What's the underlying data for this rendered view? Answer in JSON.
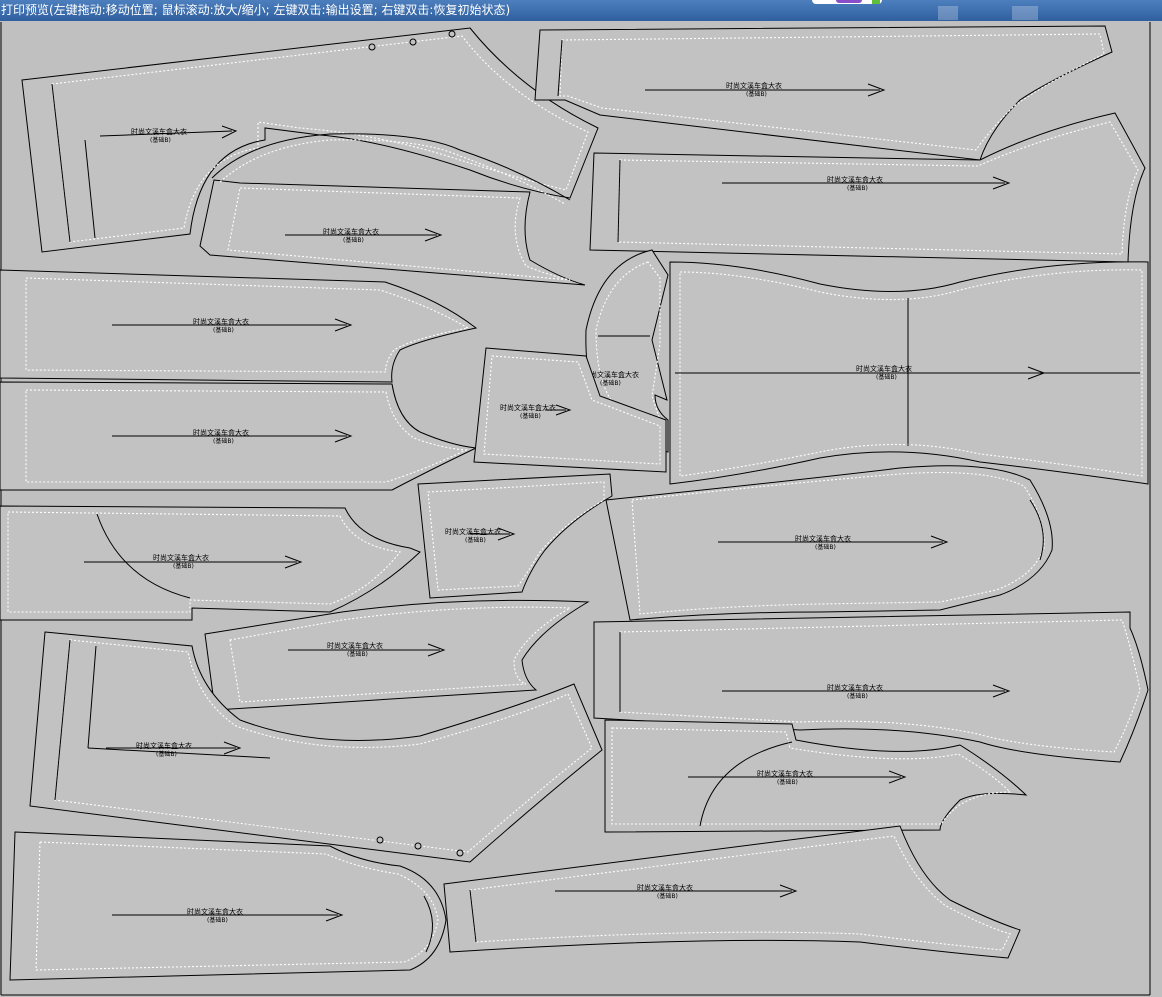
{
  "window": {
    "title": "打印预览(左键拖动:移动位置; 鼠标滚动:放大/缩小; 左键双击:输出设置; 右键双击:恢复初始状态)"
  },
  "piece_label": {
    "name": "时尚文溪车盒大衣",
    "sub": "(基础B)"
  },
  "colors": {
    "background": "#c0c0c0",
    "titlebar": "#3b6ba8",
    "piece_fill": "#c2c2c2",
    "outline": "#000000",
    "seam": "#ffffff"
  }
}
